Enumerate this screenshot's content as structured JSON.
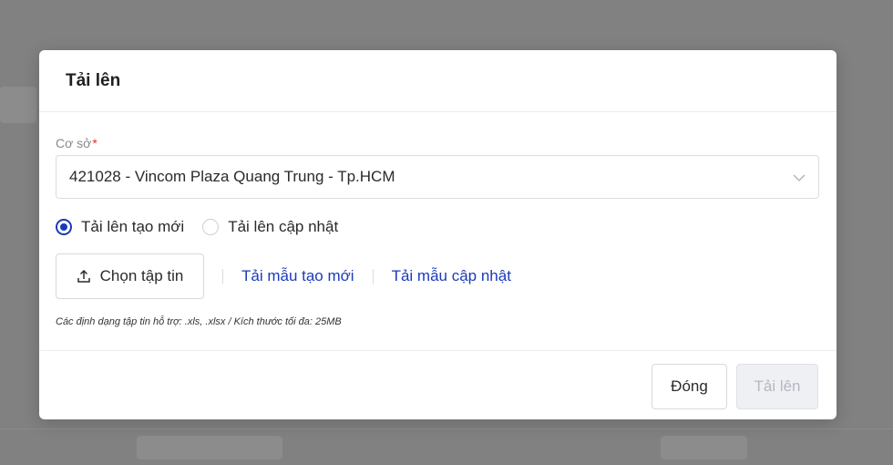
{
  "modal": {
    "title": "Tải lên",
    "facility": {
      "label": "Cơ sở",
      "required_mark": "*",
      "selected_value": "421028 - Vincom Plaza Quang Trung - Tp.HCM"
    },
    "mode_options": [
      {
        "label": "Tải lên tạo mới",
        "checked": true
      },
      {
        "label": "Tải lên cập nhật",
        "checked": false
      }
    ],
    "choose_file_label": "Chọn tập tin",
    "template_new_link": "Tải mẫu tạo mới",
    "template_update_link": "Tải mẫu cập nhật",
    "hint": "Các định dạng tập tin hỗ trợ: .xls, .xlsx / Kích thước tối đa: 25MB",
    "close_button": "Đóng",
    "upload_button": "Tải lên"
  },
  "colors": {
    "accent": "#1a3bb8",
    "required": "#e03131",
    "disabled_text": "#b4b8c0"
  }
}
